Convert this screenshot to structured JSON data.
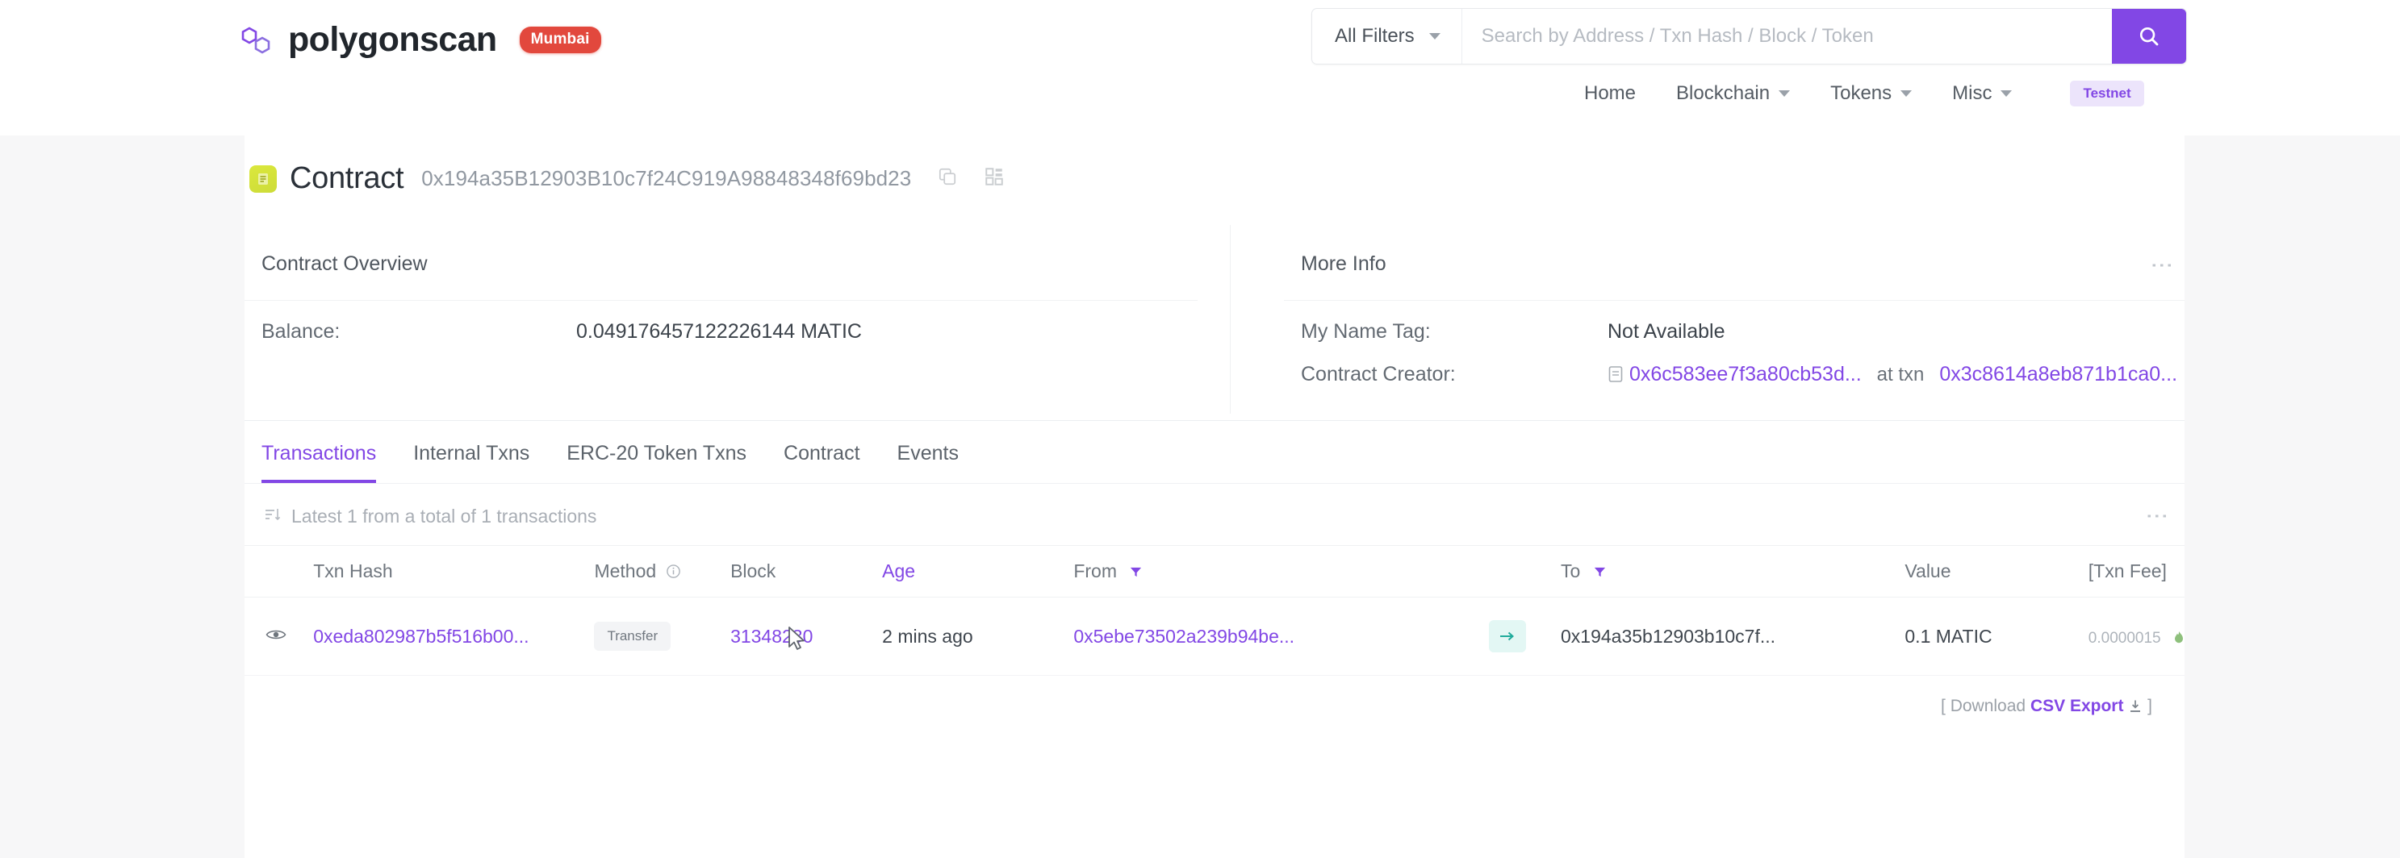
{
  "header": {
    "brand": "polygonscan",
    "network_badge": "Mumbai",
    "filters_label": "All Filters",
    "search_placeholder": "Search by Address / Txn Hash / Block / Token",
    "search_value": "",
    "search_icon": "search-icon",
    "nav": [
      {
        "label": "Home",
        "has_caret": false
      },
      {
        "label": "Blockchain",
        "has_caret": true
      },
      {
        "label": "Tokens",
        "has_caret": true
      },
      {
        "label": "Misc",
        "has_caret": true
      }
    ],
    "testnet_badge": "Testnet"
  },
  "contract": {
    "title": "Contract",
    "address": "0x194a35B12903B10c7f24C919A98848348f69bd23",
    "copy_icon": "copy-icon",
    "qr_icon": "qr-code-icon"
  },
  "overview": {
    "title": "Contract Overview",
    "balance_label": "Balance:",
    "balance_value": "0.049176457122226144 MATIC"
  },
  "more_info": {
    "title": "More Info",
    "menu_icon": "vertical-dots-icon",
    "name_tag_label": "My Name Tag:",
    "name_tag_value": "Not Available",
    "creator_label": "Contract Creator:",
    "creator_address": "0x6c583ee7f3a80cb53d...",
    "creator_at": "at txn",
    "creator_txn": "0x3c8614a8eb871b1ca0..."
  },
  "tabs": [
    {
      "label": "Transactions",
      "active": true
    },
    {
      "label": "Internal Txns",
      "active": false
    },
    {
      "label": "ERC-20 Token Txns",
      "active": false
    },
    {
      "label": "Contract",
      "active": false
    },
    {
      "label": "Events",
      "active": false
    }
  ],
  "txtable": {
    "summary": "Latest 1 from a total of 1 transactions",
    "summary_icon": "sort-list-icon",
    "menu_icon": "vertical-dots-icon",
    "columns": {
      "eye": "",
      "txn_hash": "Txn Hash",
      "method": "Method",
      "method_info_icon": "info-circle-icon",
      "block": "Block",
      "age": "Age",
      "from": "From",
      "from_filter_icon": "filter-icon",
      "arrow": "",
      "to": "To",
      "to_filter_icon": "filter-icon",
      "value": "Value",
      "fee": "[Txn Fee]"
    },
    "rows": [
      {
        "eye_icon": "eye-icon",
        "txn_hash": "0xeda802987b5f516b00...",
        "method": "Transfer",
        "block": "31348230",
        "age": "2 mins ago",
        "from": "0x5ebe73502a239b94be...",
        "direction_icon": "arrow-in-icon",
        "to": "0x194a35b12903b10c7f...",
        "value": "0.1 MATIC",
        "fee": "0.0000015",
        "fee_flame_icon": "gas-flame-icon"
      }
    ],
    "footer_prefix": "[ Download",
    "footer_link": "CSV Export",
    "footer_download_icon": "download-icon",
    "footer_suffix": "]"
  },
  "colors": {
    "accent": "#8247e5",
    "brand_badge": "#e2483d",
    "contract_icon": "#cddc39",
    "arrow_chip": "#1fab9b"
  }
}
